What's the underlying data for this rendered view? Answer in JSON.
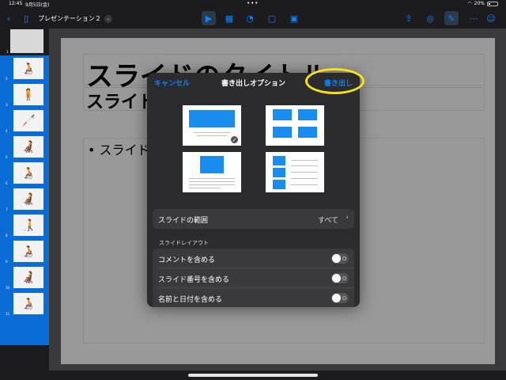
{
  "status": {
    "time": "12:45",
    "date": "9月5日(金)",
    "battery": "20%",
    "battery_level": 0.2
  },
  "toolbar": {
    "doc_title": "プレゼンテーション２"
  },
  "slide": {
    "title": "スライドのタイトル",
    "subtitle": "スライドのサブタイトル",
    "bullet": "• スライドのテキスト"
  },
  "sidebar": {
    "first_num": "1",
    "thumbs": [
      {
        "num": "2",
        "icon": "🧑‍🦽"
      },
      {
        "num": "3",
        "icon": "🧍"
      },
      {
        "num": "4",
        "icon": "🦯"
      },
      {
        "num": "5",
        "icon": "🧑‍🦼"
      },
      {
        "num": "6",
        "icon": "🧑‍🦽"
      },
      {
        "num": "7",
        "icon": "🧑‍🦼"
      },
      {
        "num": "8",
        "icon": "🧑‍🦯"
      },
      {
        "num": "9",
        "icon": "🧑‍🦽"
      },
      {
        "num": "10",
        "icon": "🧑‍🦼"
      },
      {
        "num": "11",
        "icon": "🧑‍🦽"
      }
    ]
  },
  "popover": {
    "cancel": "キャンセル",
    "title": "書き出しオプション",
    "export": "書き出し",
    "range_label": "スライドの範囲",
    "range_value": "すべて",
    "section_label": "スライドレイアウト",
    "options": [
      {
        "label": "コメントを含める"
      },
      {
        "label": "スライド番号を含める"
      },
      {
        "label": "名前と日付を含める"
      }
    ]
  }
}
